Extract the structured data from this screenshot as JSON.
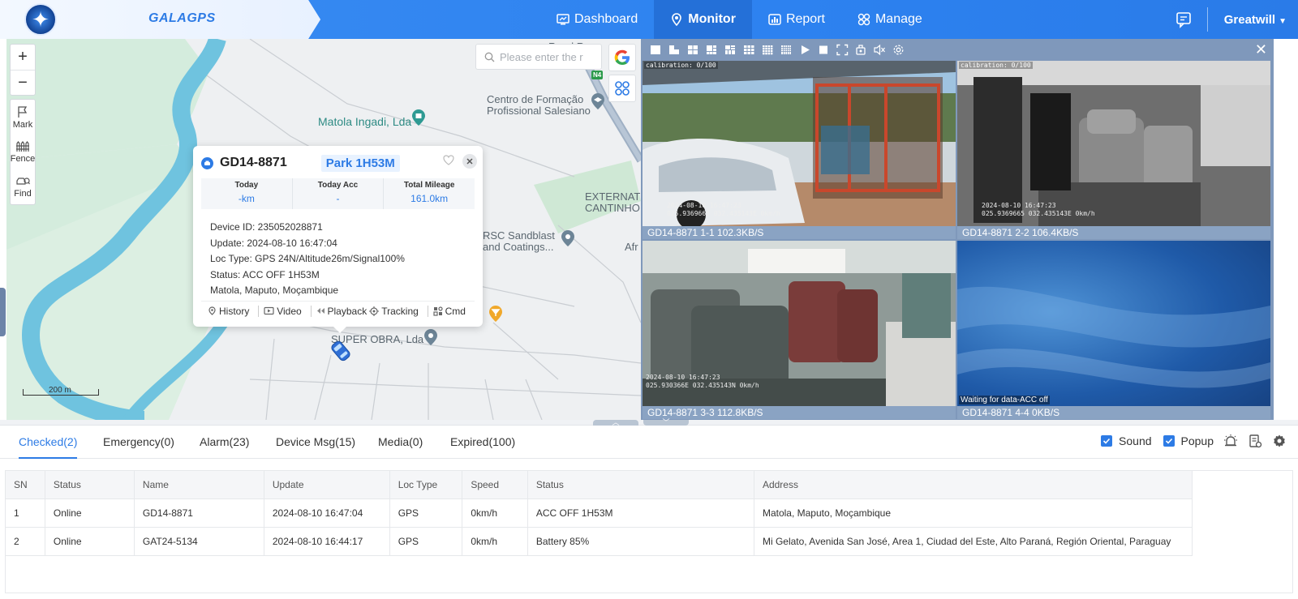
{
  "brand": {
    "name": "GALAGPS"
  },
  "nav": [
    {
      "label": "Dashboard",
      "icon": "dashboard-icon"
    },
    {
      "label": "Monitor",
      "icon": "location-pin-icon",
      "active": true
    },
    {
      "label": "Report",
      "icon": "report-icon"
    },
    {
      "label": "Manage",
      "icon": "manage-icon"
    }
  ],
  "user": {
    "name": "Greatwill"
  },
  "map": {
    "search_placeholder": "Please enter the r",
    "tools": {
      "mark": "Mark",
      "fence": "Fence",
      "find": "Find"
    },
    "scale": "200 m",
    "road_shield": "N4",
    "labels": {
      "matola_ingadi": "Matola Ingadi, Lda",
      "centro_1": "Centro de Formação",
      "centro_2": "Profissional Salesiano",
      "external_1": "EXTERNAT",
      "external_2": "CANTINHO DO CÉ",
      "rsc_1": "RSC Sandblast",
      "rsc_2": "and Coatings...",
      "afr": "Afr",
      "super_obra": "SUPER OBRA, Lda",
      "road_top": "Road R"
    }
  },
  "popup": {
    "plate": "GD14-8871",
    "park": "Park 1H53M",
    "stats": [
      {
        "label": "Today",
        "value": "-km"
      },
      {
        "label": "Today Acc",
        "value": "-"
      },
      {
        "label": "Total Mileage",
        "value": "161.0km"
      }
    ],
    "info": {
      "device_id": "Device ID: 235052028871",
      "update": "Update: 2024-08-10 16:47:04",
      "loc_type": "Loc Type: GPS 24N/Altitude26m/Signal100%",
      "status": "Status: ACC OFF 1H53M",
      "address": "Matola, Maputo, Moçambique"
    },
    "actions": {
      "history": "History",
      "video": "Video",
      "playback": "Playback",
      "tracking": "Tracking",
      "cmd": "Cmd"
    }
  },
  "video": {
    "cells": [
      {
        "caption": "GD14-8871   1-1   102.3KB/S",
        "osd": "calibration: 0/100",
        "timestamp": "2024-08-10 16:47:23",
        "coords": "025.9369665 032.435143E 0km/h"
      },
      {
        "caption": "GD14-8871   2-2   106.4KB/S",
        "osd": "calibration: 0/100",
        "timestamp": "2024-08-10 16:47:23",
        "coords": "025.9369665 032.435143E 0km/h"
      },
      {
        "caption": "GD14-8871   3-3   112.8KB/S",
        "timestamp": "2024-08-10 16:47:23",
        "coords": "025.930366E 032.435143N 0km/h"
      },
      {
        "caption": "GD14-8871   4-4   0KB/S",
        "message": "Waiting for data-ACC off"
      }
    ]
  },
  "tabs": [
    {
      "label": "Checked(2)",
      "active": true
    },
    {
      "label": "Emergency(0)"
    },
    {
      "label": "Alarm(23)"
    },
    {
      "label": "Device Msg(15)"
    },
    {
      "label": "Media(0)"
    },
    {
      "label": "Expired(100)"
    }
  ],
  "toggles": {
    "sound": "Sound",
    "popup": "Popup"
  },
  "table": {
    "headers": [
      "SN",
      "Status",
      "Name",
      "Update",
      "Loc Type",
      "Speed",
      "Status",
      "Address"
    ],
    "rows": [
      [
        "1",
        "Online",
        "GD14-8871",
        "2024-08-10 16:47:04",
        "GPS",
        "0km/h",
        "ACC OFF 1H53M",
        "Matola, Maputo, Moçambique"
      ],
      [
        "2",
        "Online",
        "GAT24-5134",
        "2024-08-10 16:44:17",
        "GPS",
        "0km/h",
        "Battery 85%",
        "Mi Gelato, Avenida San José, Area 1, Ciudad del Este, Alto Paraná, Región Oriental, Paraguay"
      ]
    ]
  }
}
